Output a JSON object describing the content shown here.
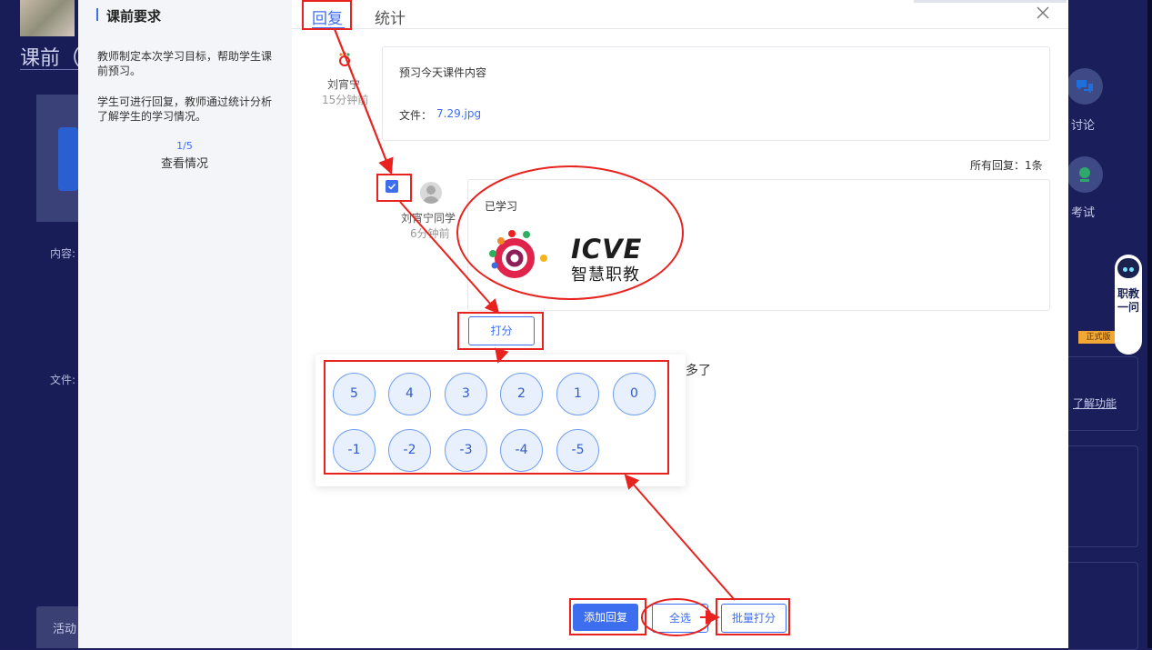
{
  "background": {
    "title": "课前（",
    "content_label": "内容:",
    "file_label": "文件:",
    "activity_label": "活动",
    "right_discuss": "讨论",
    "right_exam": "考试",
    "right_feature": "了解功能",
    "robot_label": "职教一问",
    "formal_badge": "正式版"
  },
  "sidebar": {
    "title": "课前要求",
    "desc1": "教师制定本次学习目标，帮助学生课前预习。",
    "desc2": "学生可进行回复，教师通过统计分析了解学生的学习情况。",
    "fraction": "1/5",
    "view": "查看情况"
  },
  "tabs": {
    "reply": "回复",
    "stats": "统计"
  },
  "post": {
    "author": "刘宵宁",
    "time": "15分钟前",
    "text": "预习今天课件内容",
    "file_label": "文件：",
    "file_name": "7.29.jpg"
  },
  "all_replies": "所有回复：1条",
  "reply": {
    "author": "刘宵宁同学",
    "time": "6分钟前",
    "text": "已学习",
    "logo_title": "ICVE",
    "logo_sub": "智慧职教"
  },
  "score_button": "打分",
  "overflow_text": "多了",
  "score_options": [
    "5",
    "4",
    "3",
    "2",
    "1",
    "0",
    "-1",
    "-2",
    "-3",
    "-4",
    "-5"
  ],
  "actions": {
    "add_reply": "添加回复",
    "select_all": "全选",
    "batch_score": "批量打分"
  },
  "colors": {
    "accent": "#3e6ef0",
    "annotation": "#e8231f"
  }
}
